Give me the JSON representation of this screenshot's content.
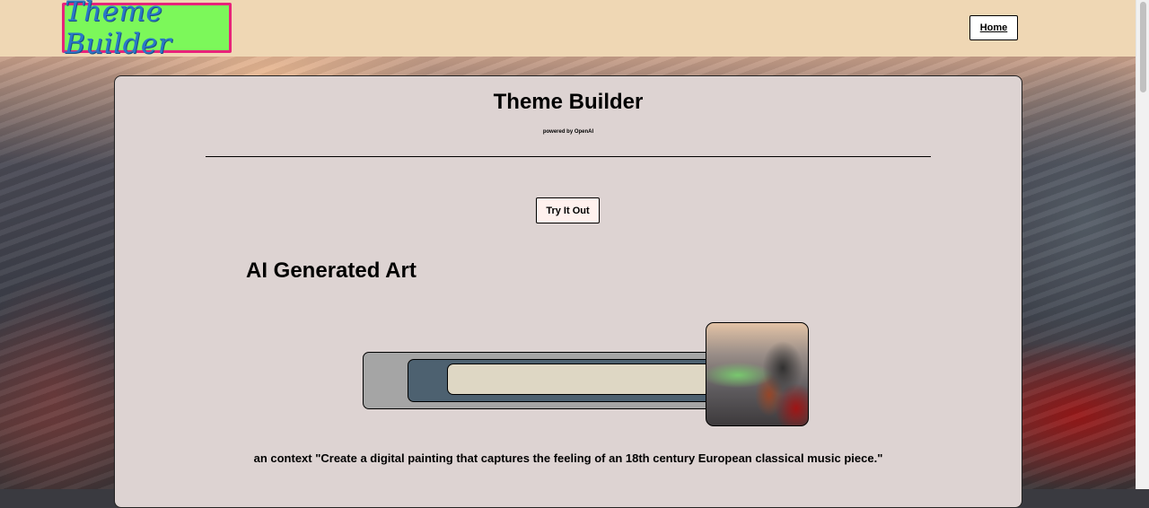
{
  "header": {
    "logo_text": "Theme Builder",
    "home_label": "Home"
  },
  "card": {
    "title": "Theme Builder",
    "powered_by": "powered by OpenAI",
    "try_button": "Try It Out",
    "section_heading": "AI Generated Art",
    "caption": "an context \"Create a digital painting that captures the feeling of an 18th century European classical music piece.\""
  },
  "colors": {
    "topbar": "#efd7b4",
    "logo_bg": "#7cf85a",
    "logo_border": "#e8237a",
    "logo_text": "#2a78c8",
    "card_bg": "#ddd3d2"
  },
  "icons": {
    "art_image": "ai-generated-painting-image"
  }
}
